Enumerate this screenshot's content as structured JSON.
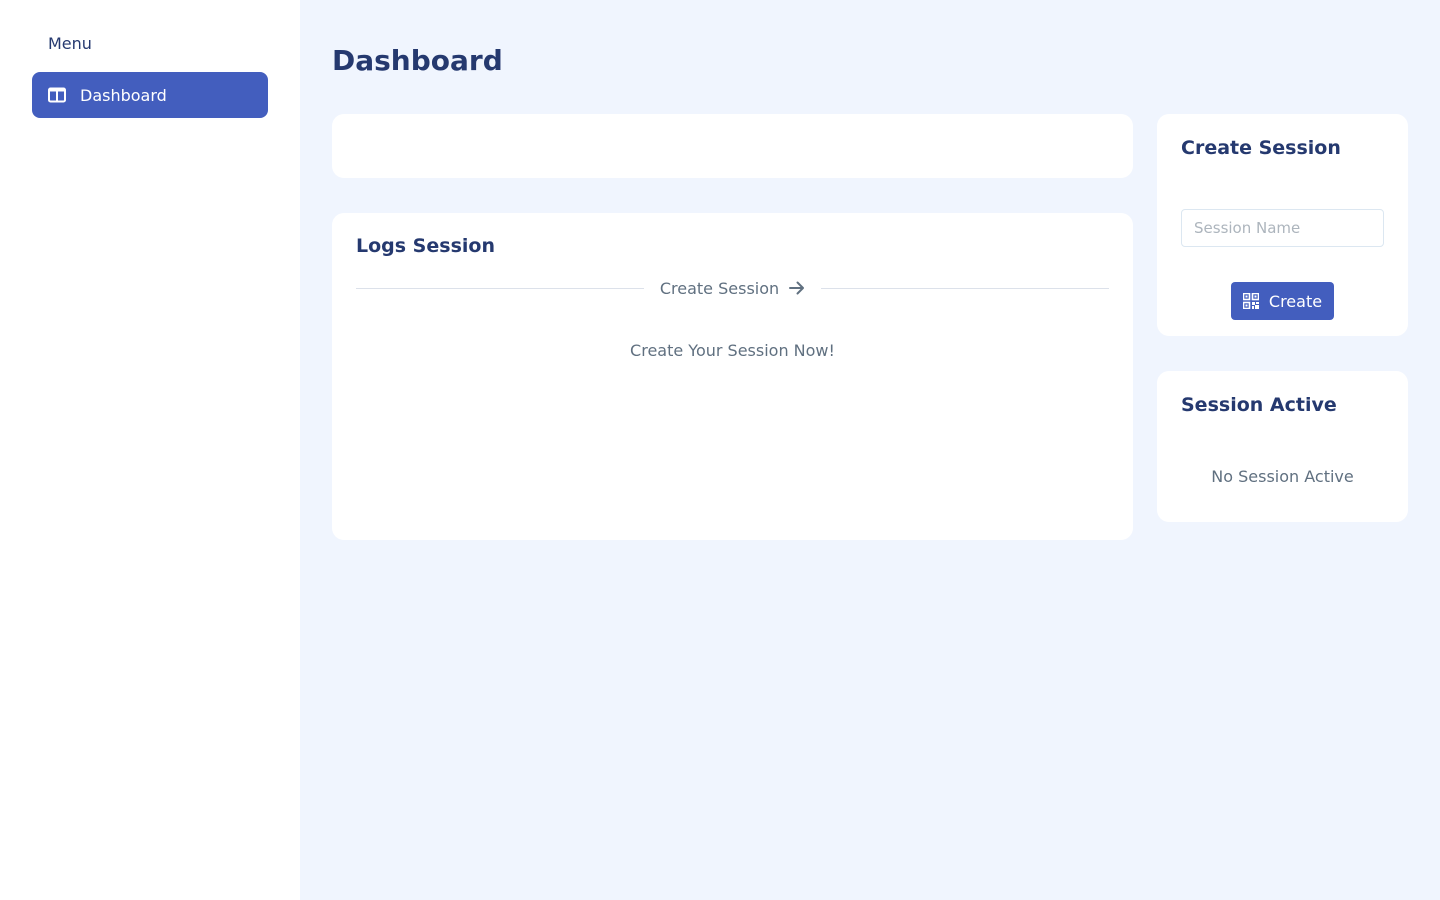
{
  "sidebar": {
    "menu_title": "Menu",
    "items": [
      {
        "label": "Dashboard",
        "icon": "layout-icon",
        "active": true
      }
    ]
  },
  "page": {
    "title": "Dashboard"
  },
  "logs": {
    "title": "Logs Session",
    "create_link": "Create Session",
    "empty_text": "Create Your Session Now!"
  },
  "create_session": {
    "title": "Create Session",
    "input_placeholder": "Session Name",
    "input_value": "",
    "button_label": "Create",
    "button_icon": "qr-code-icon"
  },
  "session_active": {
    "title": "Session Active",
    "empty_text": "No Session Active"
  },
  "colors": {
    "accent": "#435ebe",
    "heading": "#25396f",
    "muted": "#607080",
    "background": "#f0f5fe"
  }
}
